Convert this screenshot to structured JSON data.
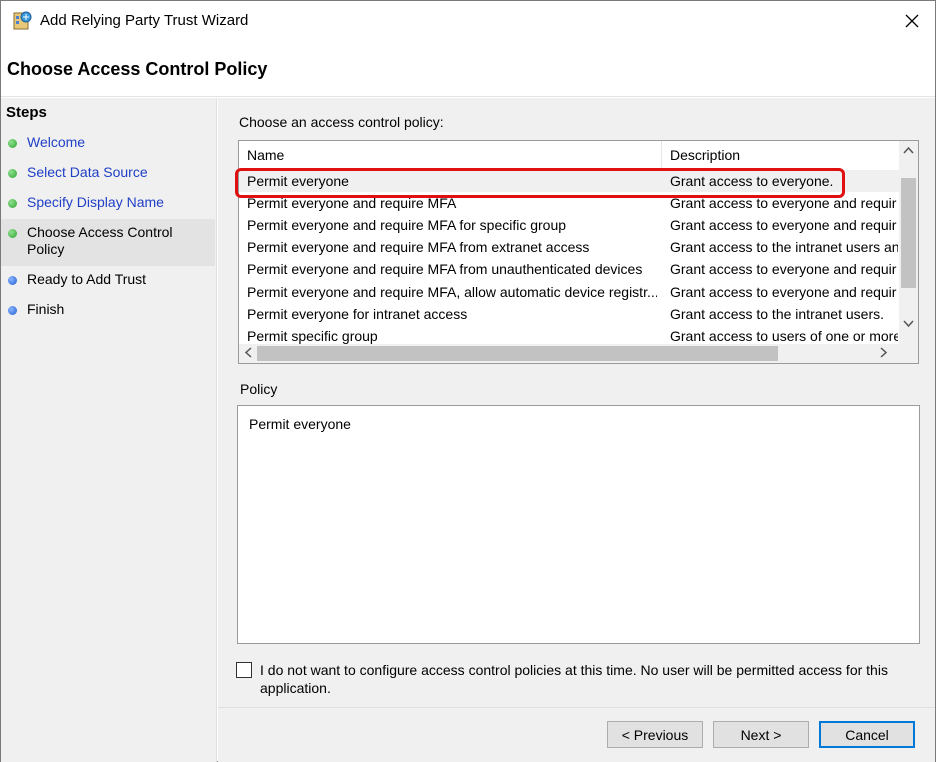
{
  "window": {
    "title": "Add Relying Party Trust Wizard",
    "page_title": "Choose Access Control Policy",
    "close_glyph": "✕"
  },
  "steps": {
    "heading": "Steps",
    "items": [
      {
        "label": "Welcome",
        "status": "done"
      },
      {
        "label": "Select Data Source",
        "status": "done"
      },
      {
        "label": "Specify Display Name",
        "status": "done"
      },
      {
        "label": "Choose Access Control Policy",
        "status": "current"
      },
      {
        "label": "Ready to Add Trust",
        "status": "pending"
      },
      {
        "label": "Finish",
        "status": "pending"
      }
    ]
  },
  "policy_list": {
    "label": "Choose an access control policy:",
    "columns": {
      "name": "Name",
      "description": "Description"
    },
    "rows": [
      {
        "name": "Permit everyone",
        "description": "Grant access to everyone.",
        "selected": true
      },
      {
        "name": "Permit everyone and require MFA",
        "description": "Grant access to everyone and requir"
      },
      {
        "name": "Permit everyone and require MFA for specific group",
        "description": "Grant access to everyone and requir"
      },
      {
        "name": "Permit everyone and require MFA from extranet access",
        "description": "Grant access to the intranet users an"
      },
      {
        "name": "Permit everyone and require MFA from unauthenticated devices",
        "description": "Grant access to everyone and requir"
      },
      {
        "name": "Permit everyone and require MFA, allow automatic device registr...",
        "description": "Grant access to everyone and requir"
      },
      {
        "name": "Permit everyone for intranet access",
        "description": "Grant access to the intranet users."
      },
      {
        "name": "Permit specific group",
        "description": "Grant access to users of one or more"
      }
    ]
  },
  "policy": {
    "label": "Policy",
    "value": "Permit everyone"
  },
  "skip_checkbox": {
    "label": "I do not want to configure access control policies at this time. No user will be permitted access for this application.",
    "checked": false
  },
  "buttons": {
    "previous": "< Previous",
    "next": "Next >",
    "cancel": "Cancel"
  },
  "colors": {
    "highlight": "#e01010",
    "link": "#1f3fc6",
    "step_done": "#2fa52f",
    "step_pending": "#1f5fd1"
  }
}
